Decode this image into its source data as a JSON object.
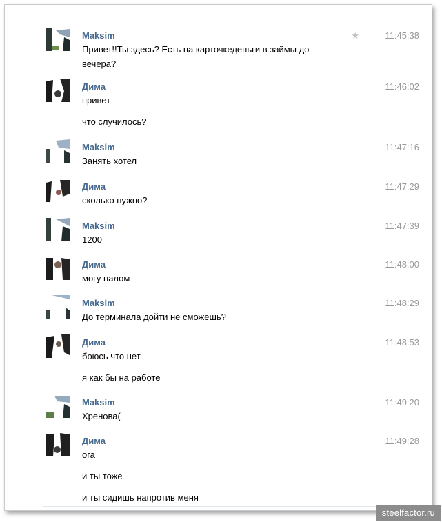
{
  "messages": [
    {
      "author": "Maksim",
      "time": "11:45:38",
      "starred": true,
      "lines": [
        "Привет!!Ты здесь? Есть на карточкеденьги в займы до вечера?"
      ]
    },
    {
      "author": "Дима",
      "time": "11:46:02",
      "lines": [
        "привет",
        "что случилось?"
      ]
    },
    {
      "author": "Maksim",
      "time": "11:47:16",
      "lines": [
        "Занять хотел"
      ]
    },
    {
      "author": "Дима",
      "time": "11:47:29",
      "lines": [
        "сколько нужно?"
      ]
    },
    {
      "author": "Maksim",
      "time": "11:47:39",
      "lines": [
        "1200"
      ]
    },
    {
      "author": "Дима",
      "time": "11:48:00",
      "lines": [
        "могу налом"
      ]
    },
    {
      "author": "Maksim",
      "time": "11:48:29",
      "lines": [
        "До терминала дойти не сможешь?"
      ]
    },
    {
      "author": "Дима",
      "time": "11:48:53",
      "lines": [
        "боюсь что нет",
        "я как бы на работе"
      ]
    },
    {
      "author": "Maksim",
      "time": "11:49:20",
      "lines": [
        "Хренова("
      ]
    },
    {
      "author": "Дима",
      "time": "11:49:28",
      "lines": [
        "ога",
        "и ты тоже",
        "и ты сидишь напротив меня"
      ]
    }
  ],
  "watermark": "steelfactor.ru",
  "colors": {
    "author": "#45688e",
    "time": "#999999",
    "text": "#000000"
  },
  "icons": {
    "star": "star-icon"
  }
}
